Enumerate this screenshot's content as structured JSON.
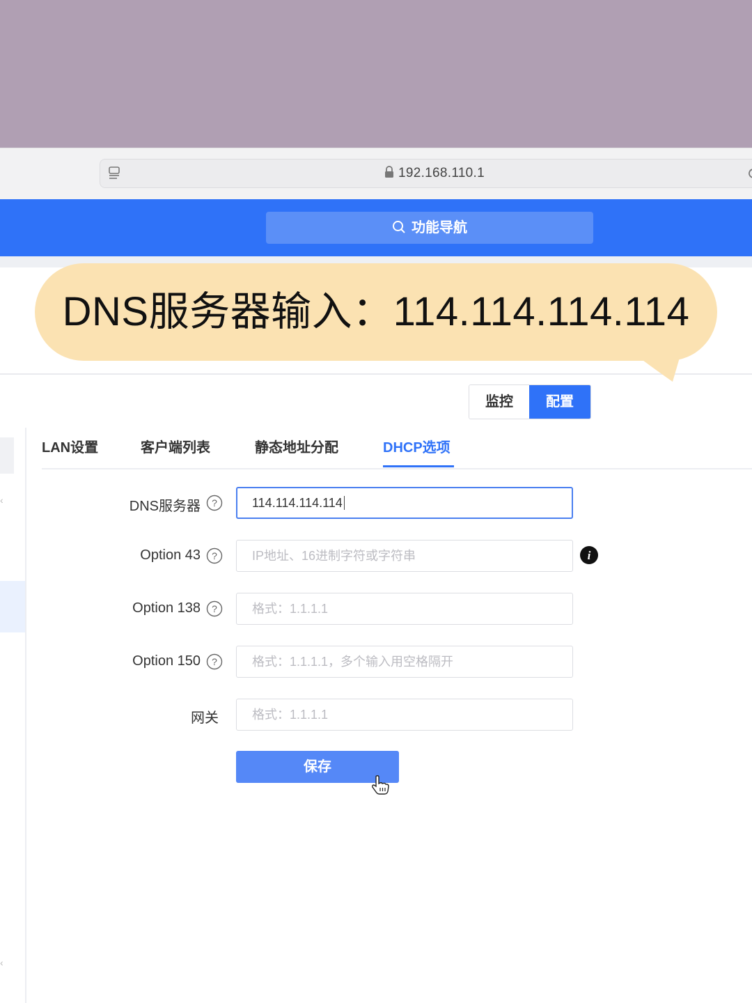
{
  "browser": {
    "url": "192.168.110.1"
  },
  "header": {
    "search_label": "功能导航"
  },
  "callout": {
    "text": "DNS服务器输入：114.114.114.114",
    "background_color": "#fbe2b2"
  },
  "mode_toggle": {
    "monitor_label": "监控",
    "config_label": "配置",
    "active": "配置"
  },
  "tabs": [
    {
      "label": "LAN设置"
    },
    {
      "label": "客户端列表"
    },
    {
      "label": "静态地址分配"
    },
    {
      "label": "DHCP选项",
      "active": true
    }
  ],
  "form": {
    "fields": [
      {
        "label": "DNS服务器",
        "value": "114.114.114.114",
        "placeholder": "",
        "help_icon": "question-circle-icon"
      },
      {
        "label": "Option 43",
        "value": "",
        "placeholder": "IP地址、16进制字符或字符串",
        "help_icon": "question-circle-icon"
      },
      {
        "label": "Option 138",
        "value": "",
        "placeholder": "格式：1.1.1.1",
        "help_icon": "question-circle-icon"
      },
      {
        "label": "Option 150",
        "value": "",
        "placeholder": "格式：1.1.1.1，多个输入用空格隔开",
        "help_icon": "question-circle-icon"
      },
      {
        "label": "网关",
        "value": "",
        "placeholder": "格式：1.1.1.1"
      }
    ],
    "save_label": "保存"
  },
  "colors": {
    "primary": "#2f72f8",
    "top_band": "#b09fb3"
  }
}
